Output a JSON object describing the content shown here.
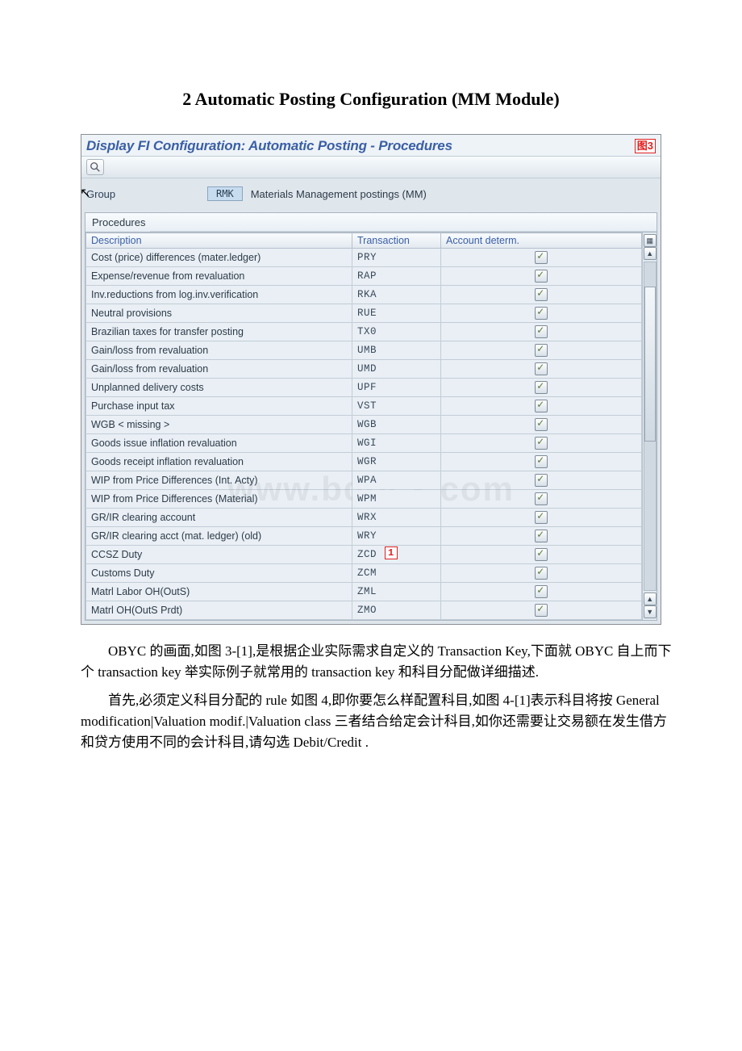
{
  "doc_title": "2 Automatic Posting Configuration (MM Module)",
  "sap": {
    "screen_title": "Display FI Configuration: Automatic Posting - Procedures",
    "figure_label": "图3",
    "group_label": "Group",
    "group_code": "RMK",
    "group_desc": "Materials Management postings (MM)",
    "tab_label": "Procedures",
    "headers": {
      "desc": "Description",
      "tx": "Transaction",
      "ad": "Account determ."
    },
    "rows": [
      {
        "desc": "Cost (price) differences (mater.ledger)",
        "tx": "PRY",
        "chk": true
      },
      {
        "desc": "Expense/revenue from revaluation",
        "tx": "RAP",
        "chk": true
      },
      {
        "desc": "Inv.reductions from log.inv.verification",
        "tx": "RKA",
        "chk": true
      },
      {
        "desc": "Neutral provisions",
        "tx": "RUE",
        "chk": true
      },
      {
        "desc": "Brazilian taxes for transfer posting",
        "tx": "TX0",
        "chk": true
      },
      {
        "desc": "Gain/loss from revaluation",
        "tx": "UMB",
        "chk": true
      },
      {
        "desc": "Gain/loss from revaluation",
        "tx": "UMD",
        "chk": true
      },
      {
        "desc": "Unplanned delivery costs",
        "tx": "UPF",
        "chk": true
      },
      {
        "desc": "Purchase input tax",
        "tx": "VST",
        "chk": true
      },
      {
        "desc": "WGB < missing >",
        "tx": "WGB",
        "chk": true
      },
      {
        "desc": "Goods issue inflation revaluation",
        "tx": "WGI",
        "chk": true
      },
      {
        "desc": "Goods receipt inflation revaluation",
        "tx": "WGR",
        "chk": true
      },
      {
        "desc": "WIP from Price Differences (Int. Acty)",
        "tx": "WPA",
        "chk": true
      },
      {
        "desc": "WIP from Price Differences (Material)",
        "tx": "WPM",
        "chk": true
      },
      {
        "desc": "GR/IR clearing account",
        "tx": "WRX",
        "chk": true
      },
      {
        "desc": "GR/IR clearing acct (mat. ledger) (old)",
        "tx": "WRY",
        "chk": true
      },
      {
        "desc": "CCSZ Duty",
        "tx": "ZCD",
        "chk": true,
        "callout": "1"
      },
      {
        "desc": "Customs Duty",
        "tx": "ZCM",
        "chk": true
      },
      {
        "desc": "Matrl Labor OH(OutS)",
        "tx": "ZML",
        "chk": true
      },
      {
        "desc": "Matrl  OH(OutS Prdt)",
        "tx": "ZMO",
        "chk": true
      }
    ]
  },
  "watermark": "www.bdocx.com",
  "paragraphs": [
    "OBYC 的画面,如图 3-[1],是根据企业实际需求自定义的 Transaction Key,下面就 OBYC 自上而下个 transaction key 举实际例子就常用的 transaction key 和科目分配做详细描述.",
    "首先,必须定义科目分配的 rule 如图 4,即你要怎么样配置科目,如图 4-[1]表示科目将按 General modification|Valuation modif.|Valuation class 三者结合给定会计科目,如你还需要让交易额在发生借方和贷方使用不同的会计科目,请勾选 Debit/Credit ."
  ]
}
